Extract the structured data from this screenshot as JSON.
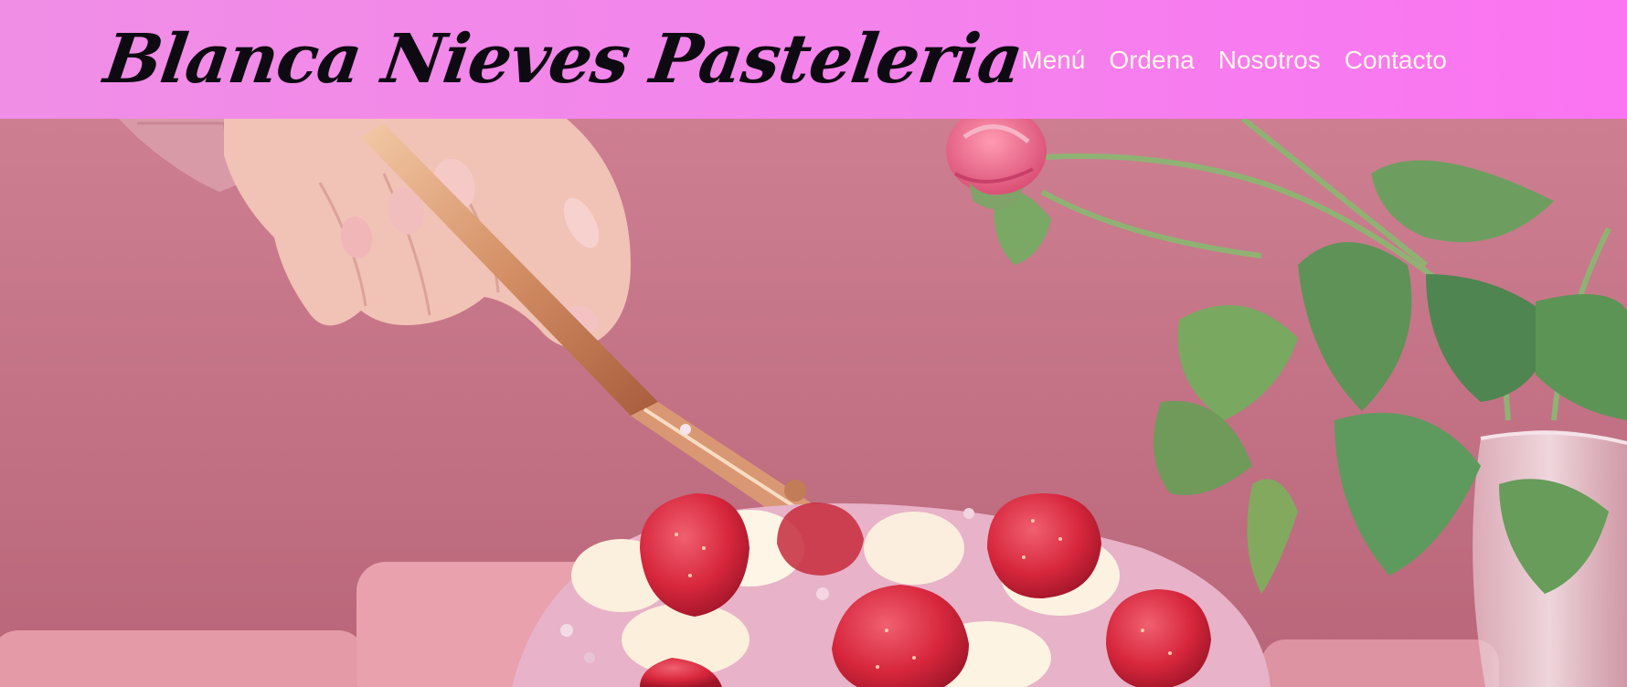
{
  "header": {
    "brand": "Blanca Nieves Pasteleria",
    "nav": [
      "Menú",
      "Ordena",
      "Nosotros",
      "Contacto"
    ]
  },
  "hero": {
    "image": "cake-cutting-photo",
    "description_icon": "photo-icon"
  },
  "colors": {
    "header_gradient_start": "#f08ee6",
    "header_gradient_end": "#fb74f2",
    "nav_text": "#fff6e4",
    "brand_text": "#0e0a12",
    "hero_background": "#c97a8c"
  }
}
